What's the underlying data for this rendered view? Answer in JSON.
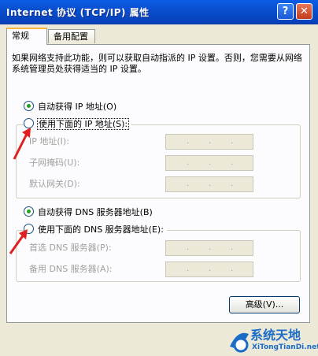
{
  "window": {
    "title": "Internet 协议 (TCP/IP) 属性",
    "help_glyph": "?",
    "close_glyph": "✕"
  },
  "tabs": [
    {
      "label": "常规",
      "selected": true
    },
    {
      "label": "备用配置",
      "selected": false
    }
  ],
  "description": "如果网络支持此功能，则可以获取自动指派的 IP 设置。否则，您需要从网络系统管理员处获得适当的 IP 设置。",
  "ip_section": {
    "auto_label": "自动获得 IP 地址(O)",
    "manual_label": "使用下面的 IP 地址(S):",
    "auto_selected": true,
    "fields": [
      {
        "label": "IP 地址(I):",
        "value": ".   .   ."
      },
      {
        "label": "子网掩码(U):",
        "value": ".   .   ."
      },
      {
        "label": "默认网关(D):",
        "value": ".   .   ."
      }
    ]
  },
  "dns_section": {
    "auto_label": "自动获得 DNS 服务器地址(B)",
    "manual_label": "使用下面的 DNS 服务器地址(E):",
    "auto_selected": true,
    "fields": [
      {
        "label": "首选 DNS 服务器(P):",
        "value": ".   .   ."
      },
      {
        "label": "备用 DNS 服务器(A):",
        "value": ".   .   ."
      }
    ]
  },
  "advanced_button": "高级(V)...",
  "watermark": {
    "brand": "系统天地",
    "url": "XiTongTianDi.net"
  },
  "colors": {
    "titlebar": "#0a4fd0",
    "arrow": "#e02020",
    "watermark": "#1a6cc7"
  }
}
